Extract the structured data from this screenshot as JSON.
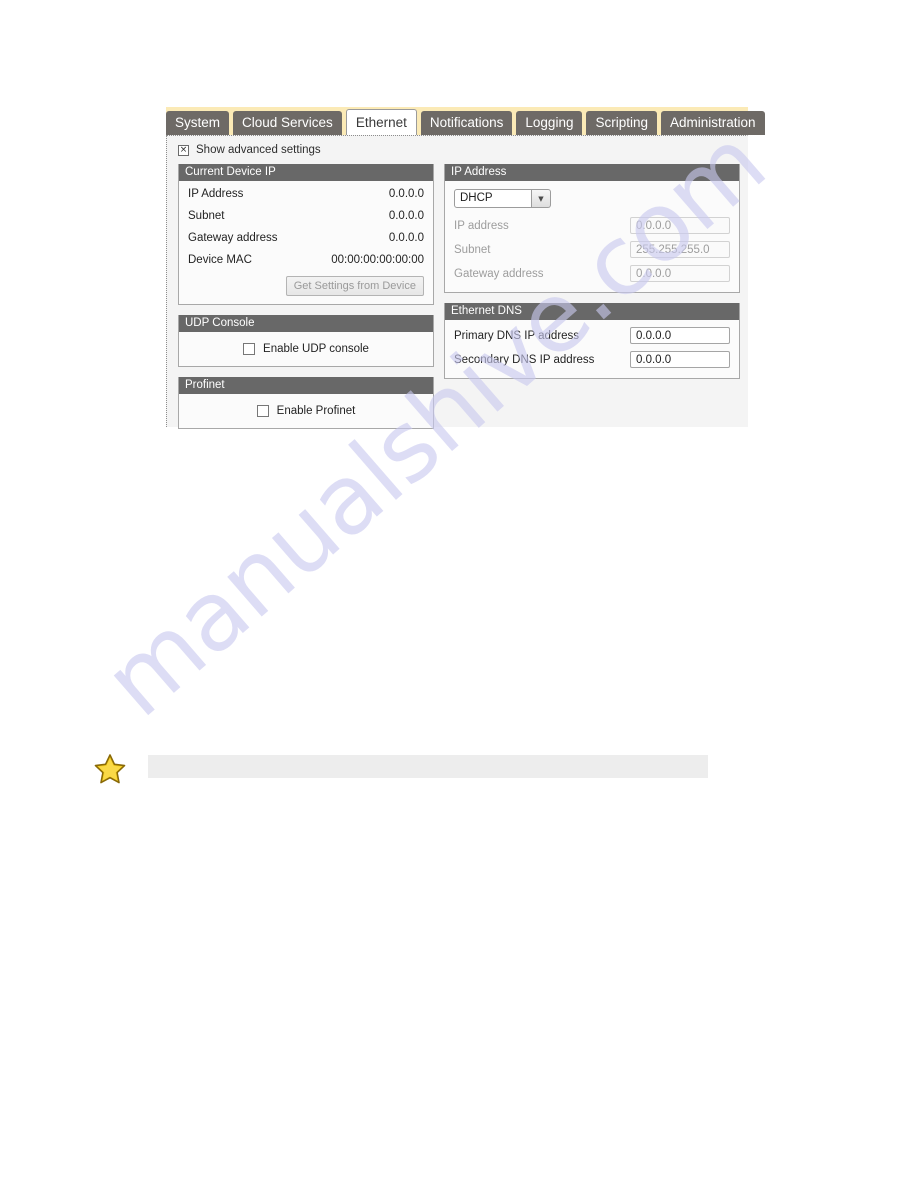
{
  "watermark": {
    "text": "manualshive.com"
  },
  "tabs": [
    {
      "label": "System",
      "active": false
    },
    {
      "label": "Cloud Services",
      "active": false
    },
    {
      "label": "Ethernet",
      "active": true
    },
    {
      "label": "Notifications",
      "active": false
    },
    {
      "label": "Logging",
      "active": false
    },
    {
      "label": "Scripting",
      "active": false
    },
    {
      "label": "Administration",
      "active": false
    }
  ],
  "advanced": {
    "label": "Show advanced settings",
    "checked": true,
    "mark": "×"
  },
  "current_device_ip": {
    "header": "Current Device IP",
    "rows": [
      {
        "label": "IP Address",
        "value": "0.0.0.0"
      },
      {
        "label": "Subnet",
        "value": "0.0.0.0"
      },
      {
        "label": "Gateway address",
        "value": "0.0.0.0"
      },
      {
        "label": "Device MAC",
        "value": "00:00:00:00:00:00"
      }
    ],
    "button_label": "Get Settings from Device"
  },
  "udp_console": {
    "header": "UDP Console",
    "checkbox_label": "Enable UDP console",
    "checked": false
  },
  "profinet": {
    "header": "Profinet",
    "checkbox_label": "Enable Profinet",
    "checked": false
  },
  "ip_address": {
    "header": "IP Address",
    "mode": "DHCP",
    "arrow": "▼",
    "fields": [
      {
        "label": "IP address",
        "value": "0.0.0.0",
        "disabled": true
      },
      {
        "label": "Subnet",
        "value": "255.255.255.0",
        "disabled": true
      },
      {
        "label": "Gateway address",
        "value": "0.0.0.0",
        "disabled": true
      }
    ]
  },
  "ethernet_dns": {
    "header": "Ethernet DNS",
    "fields": [
      {
        "label": "Primary DNS IP address",
        "value": "0.0.0.0",
        "disabled": false
      },
      {
        "label": "Secondary DNS IP address",
        "value": "0.0.0.0",
        "disabled": false
      }
    ]
  },
  "note": {
    "text": ""
  },
  "colors": {
    "tab_strip": "#fbeab6",
    "tab_inactive": "#6e6a66",
    "group_header": "#686868",
    "panel_bg": "#f4f4f4",
    "watermark": "#c9c9ef",
    "star": "#f5c51c"
  }
}
